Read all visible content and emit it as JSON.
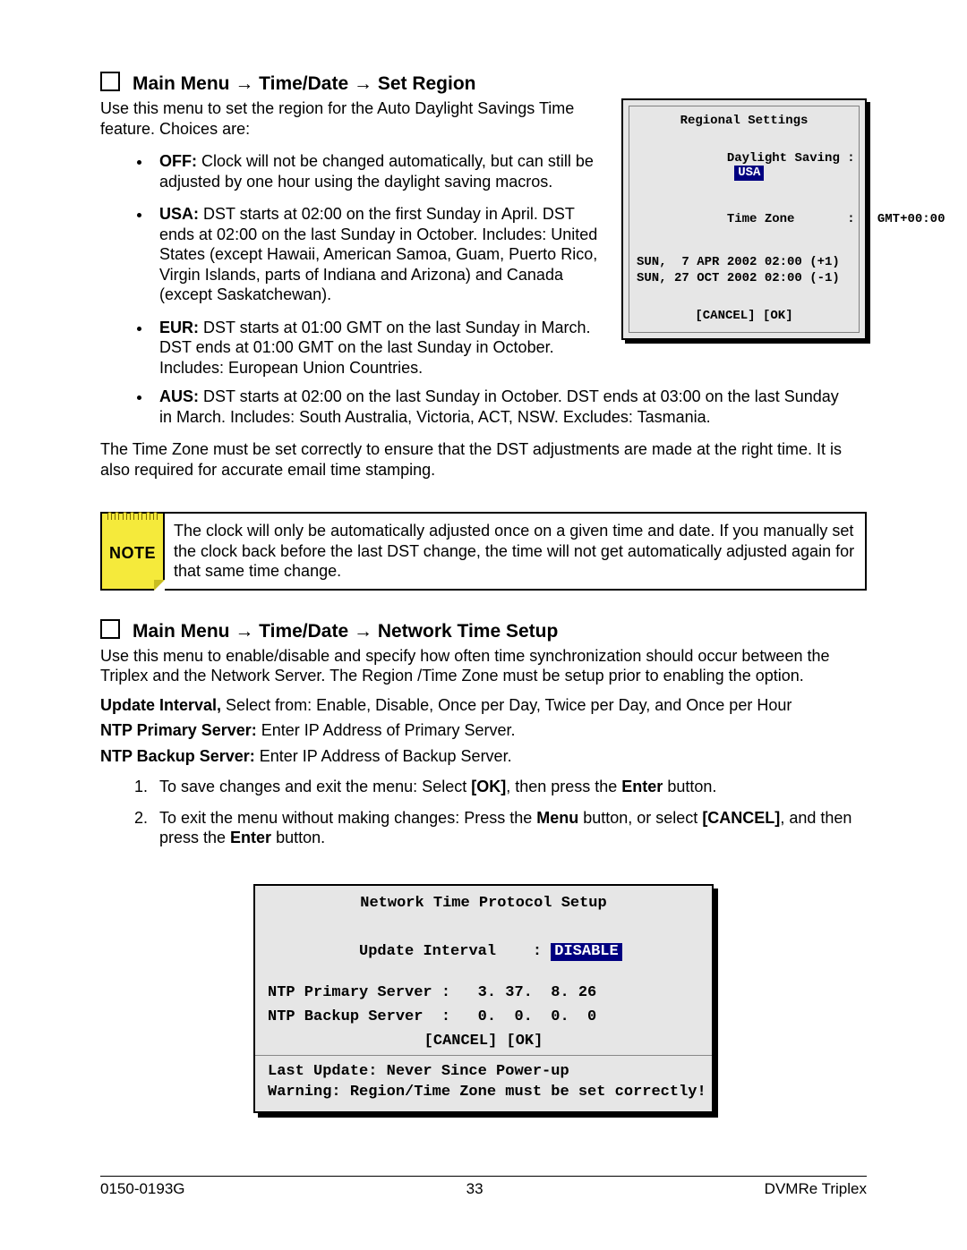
{
  "section1": {
    "heading": "Main Menu → Time/Date → Set Region",
    "intro": "Use this menu to set the region for the Auto Daylight Savings Time feature. Choices are:",
    "bullets": {
      "off_label": "OFF:",
      "off_text": " Clock will not be changed automatically, but can still be adjusted by one hour using the daylight saving macros.",
      "usa_label": "USA:",
      "usa_text": " DST starts at 02:00 on the first Sunday in April. DST ends at 02:00 on the last Sunday in October. Includes: United States (except Hawaii, American Samoa, Guam, Puerto Rico, Virgin Islands, parts of Indiana and Arizona) and Canada (except Saskatchewan).",
      "eur_label": "EUR:",
      "eur_text": " DST starts at 01:00 GMT on the last Sunday in March. DST ends at 01:00 GMT on the last Sunday in October. Includes: European Union Countries.",
      "aus_label": "AUS:",
      "aus_text": " DST starts at 02:00 on the last Sunday in October. DST ends at 03:00 on the last Sunday in March. Includes: South Australia, Victoria, ACT, NSW. Excludes: Tasmania."
    },
    "timezone_para": "The Time Zone must be set correctly to ensure that the DST adjustments are made at the right time. It is also required for accurate email time stamping.",
    "note_label": "NOTE",
    "note_text": "The clock will only be automatically adjusted once on a given time and date. If you manually set the clock back before the last DST change, the time will not get automatically adjusted again for that same time change."
  },
  "regional_panel": {
    "title": "Regional Settings",
    "dls_label": "Daylight Saving :",
    "dls_value": "USA",
    "tz_label": "Time Zone       :",
    "tz_value": "   GMT+00:00",
    "sun1": "SUN,  7 APR 2002 02:00 (+1)",
    "sun2": "SUN, 27 OCT 2002 02:00 (-1)",
    "cancel": "[CANCEL]",
    "ok": "[OK]"
  },
  "section2": {
    "heading": "Main Menu → Time/Date → Network Time Setup",
    "intro": "Use this menu to enable/disable and specify how often time synchronization should occur between the Triplex and the Network Server. The Region /Time Zone must be setup prior to enabling the option.",
    "update_label": "Update Interval,",
    "update_text": " Select from: Enable, Disable, Once per Day, Twice per Day, and Once per Hour",
    "primary_label": "NTP Primary Server:",
    "primary_text": " Enter IP Address of Primary Server.",
    "backup_label": "NTP Backup Server:",
    "backup_text": " Enter IP Address of Backup Server.",
    "step1_a": "To save changes and exit the menu:  Select ",
    "step1_b": "[OK]",
    "step1_c": ", then press the ",
    "step1_d": "Enter",
    "step1_e": " button.",
    "step2_a": "To exit the menu without making changes:  Press the ",
    "step2_b": "Menu",
    "step2_c": " button, or select ",
    "step2_d": "[CANCEL]",
    "step2_e": ", and then press the ",
    "step2_f": "Enter",
    "step2_g": " button."
  },
  "ntp_panel": {
    "title": "Network Time Protocol Setup",
    "row1_label": "Update Interval    : ",
    "row1_value": "DISABLE",
    "row2": "NTP Primary Server :   3. 37.  8. 26",
    "row3": "NTP Backup Server  :   0.  0.  0.  0",
    "cancel": "[CANCEL]",
    "ok": "[OK]",
    "last": "Last Update: Never Since Power-up",
    "warn": "Warning: Region/Time Zone must be set correctly!"
  },
  "footer": {
    "left": "0150-0193G",
    "center": "33",
    "right": "DVMRe Triplex"
  }
}
